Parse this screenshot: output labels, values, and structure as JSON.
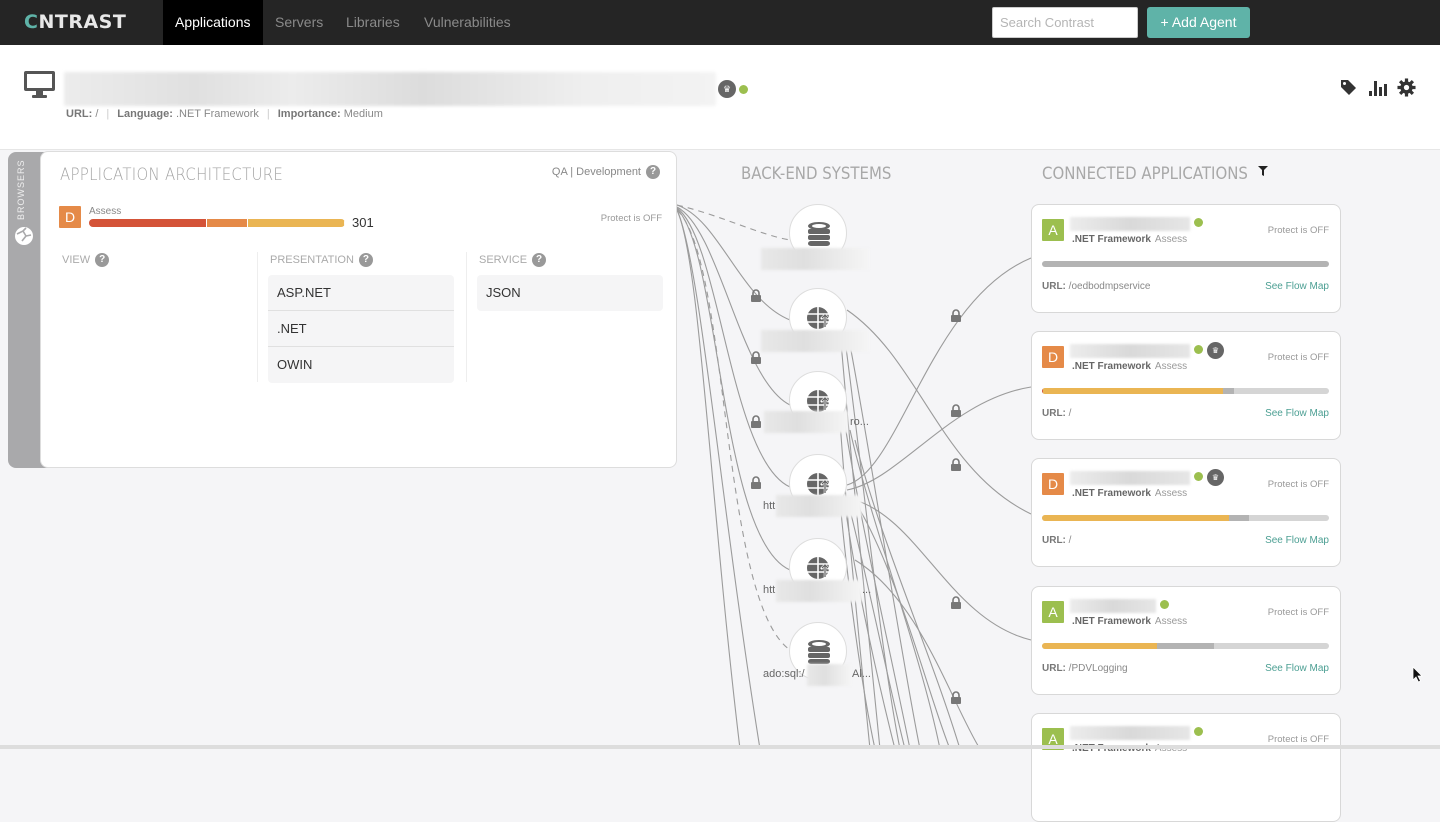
{
  "nav": {
    "logo": {
      "prefix": "C",
      "rest": "NTRAST",
      "full": "CONTRAST"
    },
    "tabs": [
      {
        "label": "Applications",
        "active": true
      },
      {
        "label": "Servers",
        "active": false
      },
      {
        "label": "Libraries",
        "active": false
      },
      {
        "label": "Vulnerabilities",
        "active": false
      }
    ],
    "search_placeholder": "Search Contrast",
    "search_value": "",
    "add_agent_label": "+ Add Agent",
    "accent": "#5fb3a8"
  },
  "header": {
    "app_name": "[redacted]",
    "status": "online",
    "url_label": "URL:",
    "url_value": "/",
    "language_label": "Language:",
    "language_value": ".NET Framework",
    "importance_label": "Importance:",
    "importance_value": "Medium",
    "icons": [
      "tag-icon",
      "bar-chart-icon",
      "gear-icon"
    ]
  },
  "architecture": {
    "side_tab_label": "BROWSERS",
    "title": "APPLICATION ARCHITECTURE",
    "environment": "QA | Development",
    "grade": "D",
    "mode": "Assess",
    "vuln_count": "301",
    "risk_segments": [
      {
        "severity": "critical",
        "fraction": 0.46,
        "color": "#d45338"
      },
      {
        "severity": "high",
        "fraction": 0.16,
        "color": "#e58a48"
      },
      {
        "severity": "medium",
        "fraction": 0.38,
        "color": "#eab553"
      }
    ],
    "protect_status": "Protect is OFF",
    "columns": [
      {
        "label": "VIEW",
        "items": []
      },
      {
        "label": "PRESENTATION",
        "items": [
          "ASP.NET",
          ".NET",
          "OWIN"
        ]
      },
      {
        "label": "SERVICE",
        "items": [
          "JSON"
        ]
      }
    ]
  },
  "backend": {
    "title": "BACK-END SYSTEMS",
    "nodes": [
      {
        "type": "database",
        "label": ""
      },
      {
        "type": "web-service",
        "label": ""
      },
      {
        "type": "web-service",
        "label_suffix": "ro..."
      },
      {
        "type": "web-service",
        "label_prefix": "htt"
      },
      {
        "type": "web-service",
        "label_prefix": "htt",
        "label_suffix": "..."
      },
      {
        "type": "database",
        "label_prefix": "ado:sql:/",
        "label_suffix": "Al..."
      }
    ]
  },
  "connected": {
    "title": "CONNECTED APPLICATIONS",
    "see_flow_label": "See Flow Map",
    "framework": ".NET Framework",
    "mode": "Assess",
    "protect_status": "Protect is OFF",
    "url_label": "URL:",
    "apps": [
      {
        "grade": "A",
        "crown": false,
        "url": "/oedbodmpservice",
        "bar": [
          {
            "fraction": 1.0,
            "color": "#b3b3b3"
          }
        ]
      },
      {
        "grade": "D",
        "crown": true,
        "url": "/",
        "bar": [
          {
            "fraction": 0.005,
            "color": "#d45338"
          },
          {
            "fraction": 0.625,
            "color": "#eab553"
          },
          {
            "fraction": 0.04,
            "color": "#b3b3b3"
          }
        ]
      },
      {
        "grade": "D",
        "crown": true,
        "url": "/",
        "bar": [
          {
            "fraction": 0.65,
            "color": "#eab553"
          },
          {
            "fraction": 0.07,
            "color": "#b3b3b3"
          }
        ]
      },
      {
        "grade": "A",
        "crown": false,
        "url": "/PDVLogging",
        "bar": [
          {
            "fraction": 0.4,
            "color": "#eab553"
          },
          {
            "fraction": 0.2,
            "color": "#b3b3b3"
          }
        ]
      },
      {
        "grade": "A",
        "crown": false,
        "url": "",
        "bar": []
      }
    ]
  }
}
